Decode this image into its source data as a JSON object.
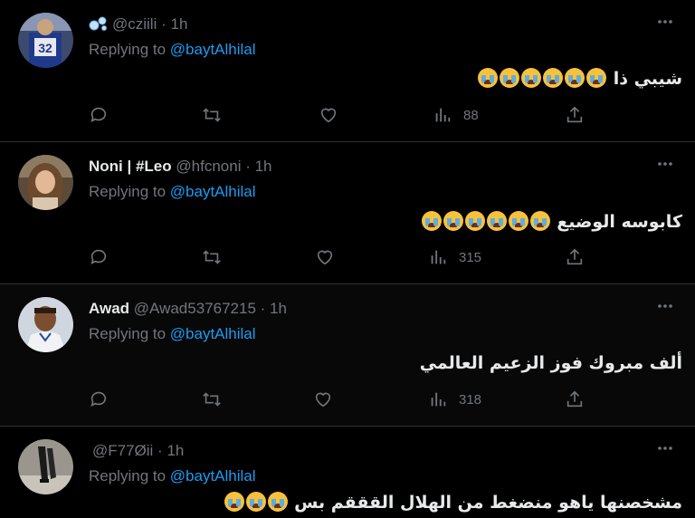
{
  "tweets": [
    {
      "name": "",
      "handle": "@cziili",
      "time": "1h",
      "reply_prefix": "Replying to",
      "reply_mention": "@baytAlhilal",
      "text": "شيبي ذا",
      "emoji_count": 6,
      "views": "88"
    },
    {
      "name": "Noni | #Leo",
      "handle": "@hfcnoni",
      "time": "1h",
      "reply_prefix": "Replying to",
      "reply_mention": "@baytAlhilal",
      "text": "كابوسه الوضيع",
      "emoji_count": 6,
      "views": "315"
    },
    {
      "name": "Awad",
      "handle": "@Awad53767215",
      "time": "1h",
      "reply_prefix": "Replying to",
      "reply_mention": "@baytAlhilal",
      "text": "ألف مبروك فوز الزعيم العالمي",
      "emoji_count": 0,
      "views": "318"
    },
    {
      "name": "",
      "handle": "@F77Øii",
      "time": "1h",
      "reply_prefix": "Replying to",
      "reply_mention": "@baytAlhilal",
      "text": "مشخصنها ياهو منضغط من الهلال القققم بس",
      "emoji_count": 3,
      "views": ""
    }
  ],
  "colors": {
    "background": "#000000",
    "divider": "#2f3336",
    "muted": "#71767b",
    "accent": "#1d9bf0",
    "text": "#e7e9ea"
  },
  "icons": {
    "reply": "reply-icon",
    "retweet": "retweet-icon",
    "like": "heart-icon",
    "views": "views-icon",
    "share": "share-icon",
    "more": "more-icon"
  }
}
